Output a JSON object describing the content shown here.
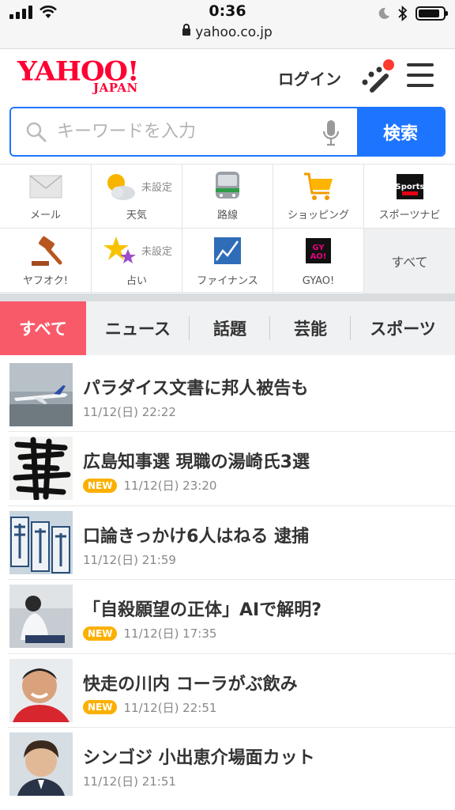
{
  "statusbar": {
    "time": "0:36",
    "url": "yahoo.co.jp",
    "battery_level": 0.85
  },
  "header": {
    "logo_main": "YAHOO!",
    "logo_sub": "JAPAN",
    "login": "ログイン"
  },
  "search": {
    "placeholder": "キーワードを入力",
    "button": "検索"
  },
  "services": [
    {
      "label": "メール",
      "icon": "mail-icon"
    },
    {
      "label": "天気",
      "sub": "未設定",
      "icon": "weather-icon"
    },
    {
      "label": "路線",
      "icon": "train-icon"
    },
    {
      "label": "ショッピング",
      "icon": "cart-icon"
    },
    {
      "label": "スポーツナビ",
      "icon": "sportsnavi-icon"
    },
    {
      "label": "ヤフオク!",
      "icon": "auction-gavel-icon"
    },
    {
      "label": "占い",
      "sub": "未設定",
      "icon": "fortune-stars-icon"
    },
    {
      "label": "ファイナンス",
      "icon": "finance-chart-icon"
    },
    {
      "label": "GYAO!",
      "icon": "gyao-icon"
    },
    {
      "label": "すべて"
    }
  ],
  "tabs": [
    "すべて",
    "ニュース",
    "話題",
    "芸能",
    "スポーツ"
  ],
  "news": [
    {
      "title": "パラダイス文書に邦人被告も",
      "date": "11/12(日) 22:22",
      "new": false
    },
    {
      "title": "広島知事選 現職の湯崎氏3選",
      "date": "11/12(日) 23:20",
      "new": true
    },
    {
      "title": "口論きっかけ6人はねる 逮捕",
      "date": "11/12(日) 21:59",
      "new": false
    },
    {
      "title": "「自殺願望の正体」AIで解明?",
      "date": "11/12(日) 17:35",
      "new": true
    },
    {
      "title": "快走の川内 コーラがぶ飲み",
      "date": "11/12(日) 22:51",
      "new": true
    },
    {
      "title": "シンゴジ 小出恵介場面カット",
      "date": "11/12(日) 21:51",
      "new": false
    }
  ],
  "new_badge": "NEW",
  "colors": {
    "brand": "#ff0033",
    "search_blue": "#1d75ff",
    "tab_active": "#f95a6a",
    "new_badge": "#fbb000"
  }
}
